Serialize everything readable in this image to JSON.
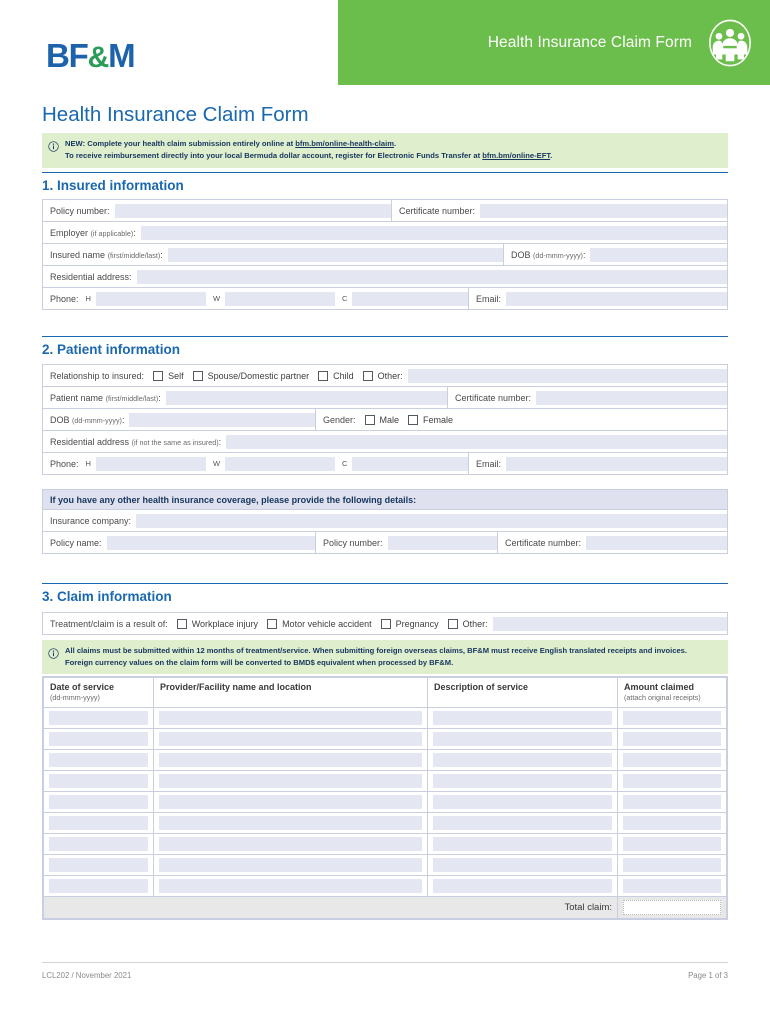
{
  "header": {
    "logo_text": {
      "part1": "BF",
      "amp": "&",
      "part2": "M"
    },
    "band_title": "Health Insurance Claim Form",
    "band_color": "#6cbe4c",
    "icon": "family-group-icon"
  },
  "page_title": "Health Insurance Claim Form",
  "notice_top": {
    "line1_pre": "NEW: Complete your health claim submission entirely online at ",
    "line1_link": "bfm.bm/online-health-claim",
    "line1_post": ".",
    "line2_pre": "To receive reimbursement directly into your local Bermuda dollar account, register for Electronic Funds Transfer at ",
    "line2_link": "bfm.bm/online-EFT",
    "line2_post": ".",
    "bg_color": "#dfeecd"
  },
  "section1": {
    "heading": "1. Insured information",
    "policy_number_label": "Policy number:",
    "certificate_number_label": "Certificate number:",
    "employer_label": "Employer",
    "employer_hint": "(if applicable)",
    "employer_colon": ":",
    "insured_name_label": "Insured name",
    "insured_name_hint": "(first/middle/last)",
    "insured_name_colon": ":",
    "dob_label": "DOB",
    "dob_hint": "(dd-mmm-yyyy)",
    "dob_colon": ":",
    "residential_address_label": "Residential address:",
    "phone_label": "Phone:",
    "phone_h": "H",
    "phone_w": "W",
    "phone_c": "C",
    "email_label": "Email:"
  },
  "section2": {
    "heading": "2. Patient information",
    "relationship_label": "Relationship to insured:",
    "relationship_options": [
      "Self",
      "Spouse/Domestic partner",
      "Child",
      "Other:"
    ],
    "patient_name_label": "Patient name",
    "patient_name_hint": "(first/middle/last)",
    "patient_name_colon": ":",
    "certificate_number_label": "Certificate number:",
    "dob_label": "DOB",
    "dob_hint": "(dd-mmm-yyyy)",
    "dob_colon": ":",
    "gender_label": "Gender:",
    "gender_options": [
      "Male",
      "Female"
    ],
    "residential_address_label": "Residential address",
    "residential_address_hint": "(if not the same as insured)",
    "residential_address_colon": ":",
    "phone_label": "Phone:",
    "phone_h": "H",
    "phone_w": "W",
    "phone_c": "C",
    "email_label": "Email:",
    "other_coverage_bar": "If you have any other health insurance coverage, please provide the following details:",
    "insurance_company_label": "Insurance company:",
    "policy_name_label": "Policy name:",
    "policy_number_label": "Policy number:",
    "other_certificate_number_label": "Certificate number:"
  },
  "section3": {
    "heading": "3. Claim information",
    "treatment_label": "Treatment/claim is a result of:",
    "treatment_options": [
      "Workplace injury",
      "Motor vehicle accident",
      "Pregnancy",
      "Other:"
    ],
    "notice": {
      "line1": "All claims must be submitted within 12 months of treatment/service. When submitting foreign overseas claims, BF&M must receive English translated receipts and invoices.",
      "line2": "Foreign currency values on the claim form will be converted to BMD$ equivalent when processed by BF&M."
    },
    "table": {
      "columns": [
        {
          "label": "Date of service",
          "hint": "(dd-mmm-yyyy)"
        },
        {
          "label": "Provider/Facility name and location",
          "hint": ""
        },
        {
          "label": "Description of service",
          "hint": ""
        },
        {
          "label": "Amount claimed",
          "hint": "(attach original receipts)"
        }
      ],
      "rows": [
        [
          "",
          "",
          "",
          ""
        ],
        [
          "",
          "",
          "",
          ""
        ],
        [
          "",
          "",
          "",
          ""
        ],
        [
          "",
          "",
          "",
          ""
        ],
        [
          "",
          "",
          "",
          ""
        ],
        [
          "",
          "",
          "",
          ""
        ],
        [
          "",
          "",
          "",
          ""
        ],
        [
          "",
          "",
          "",
          ""
        ],
        [
          "",
          "",
          "",
          ""
        ]
      ],
      "total_label": "Total claim:",
      "total_value": ""
    }
  },
  "footer": {
    "doc_ref": "LCL202 / November 2021",
    "page_indicator": "Page 1 of 3"
  }
}
